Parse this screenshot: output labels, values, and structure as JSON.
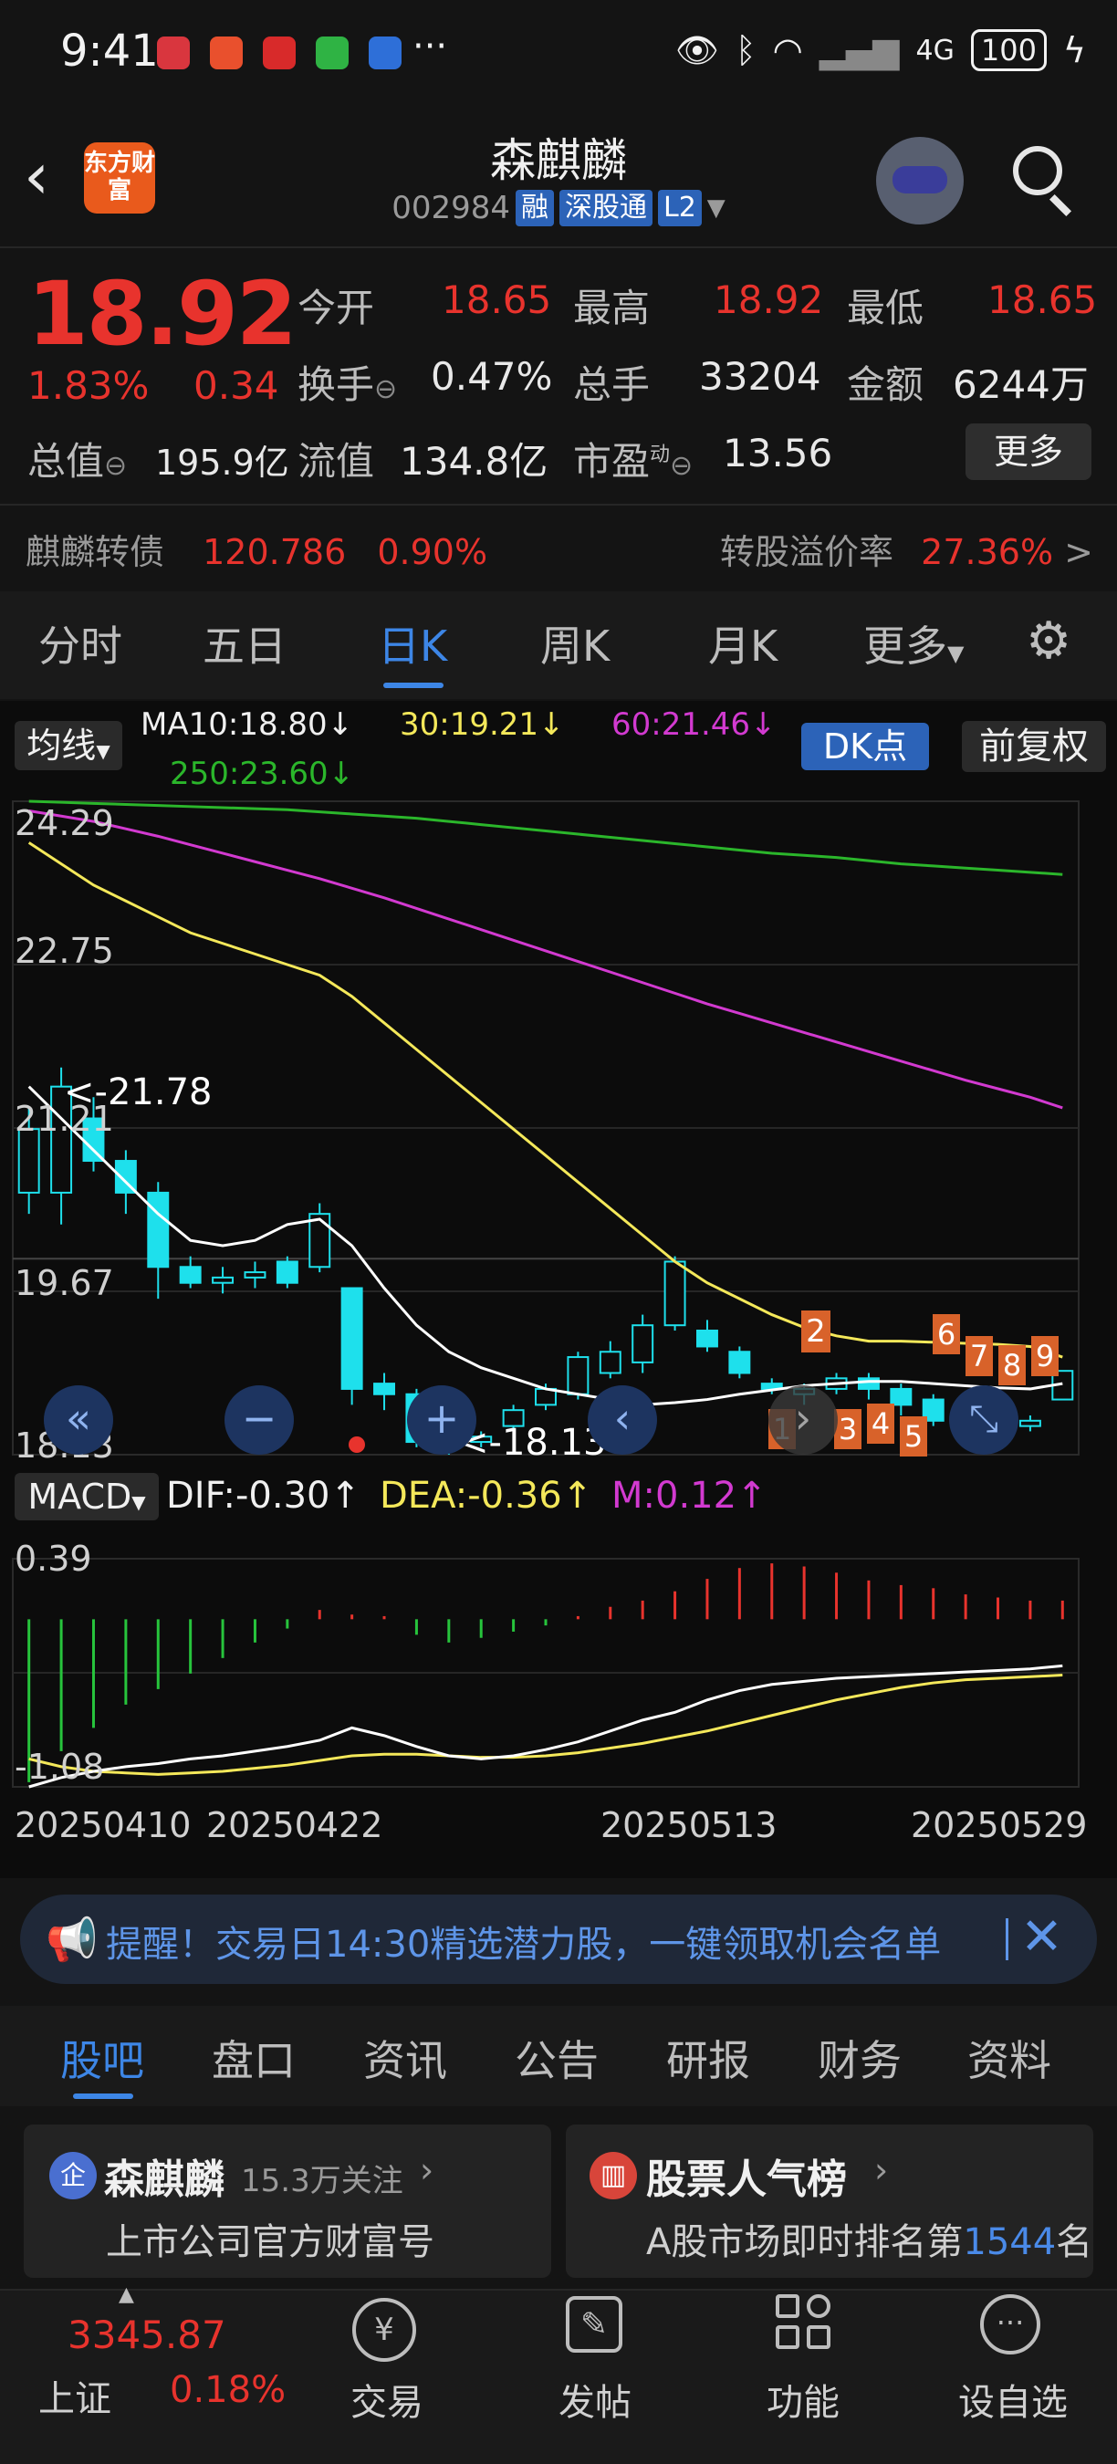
{
  "status_bar": {
    "time": "9:41",
    "more": "···",
    "network": "4G",
    "battery": "100"
  },
  "header": {
    "back_icon": "chevron-left-icon",
    "logo_text": "东方财富",
    "stock_name": "森麒麟",
    "stock_code": "002984",
    "tags": [
      "融",
      "深股通",
      "L2"
    ]
  },
  "quote": {
    "price": "18.92",
    "change_pct": "1.83%",
    "change": "0.34",
    "open_label": "今开",
    "open": "18.65",
    "high_label": "最高",
    "high": "18.92",
    "low_label": "最低",
    "low": "18.65",
    "turnover_label": "换手",
    "turnover": "0.47%",
    "volume_label": "总手",
    "volume": "33204",
    "amount_label": "金额",
    "amount": "6244万",
    "mktcap_label": "总值",
    "mktcap": "195.9亿",
    "float_label": "流值",
    "float": "134.8亿",
    "pe_label": "市盈",
    "pe_sup": "动",
    "pe": "13.56",
    "more_button": "更多"
  },
  "bond": {
    "name": "麒麟转债",
    "price": "120.786",
    "pct": "0.90%",
    "premium_label": "转股溢价率",
    "premium": "27.36%"
  },
  "period_tabs": [
    "分时",
    "五日",
    "日K",
    "周K",
    "月K",
    "更多"
  ],
  "kline": {
    "ma_select": "均线",
    "ma10": "MA10:18.80↓",
    "ma30": "30:19.21↓",
    "ma60": "60:21.46↓",
    "ma250": "250:23.60↓",
    "dk_button": "DK点",
    "adjust_button": "前复权",
    "y_labels": [
      "24.29",
      "22.75",
      "21.21",
      "19.67",
      "18.13"
    ],
    "max_label": "<-21.78",
    "min_label": "<-18.13",
    "td_numbers": [
      "2",
      "1",
      "3",
      "4",
      "5",
      "6",
      "7",
      "8",
      "9"
    ],
    "macd_select": "MACD",
    "dif": "DIF:-0.30↑",
    "dea": "DEA:-0.36↑",
    "m": "M:0.12↑",
    "macd_top": "0.39",
    "macd_bottom": "-1.08",
    "dates": [
      "20250410",
      "20250422",
      "20250513",
      "20250529"
    ],
    "colors": {
      "up": "#e8332d",
      "down": "#1ee0ec",
      "ma10": "#ffffff",
      "ma30": "#f4e85a",
      "ma60": "#d23ad0",
      "ma250": "#2bb62b"
    }
  },
  "chart_data": {
    "type": "candlestick",
    "y_range": [
      18.13,
      24.29
    ],
    "candles": [
      {
        "o": 20.6,
        "c": 21.2,
        "h": 21.4,
        "l": 20.4
      },
      {
        "o": 20.6,
        "c": 21.6,
        "h": 21.78,
        "l": 20.3
      },
      {
        "o": 21.3,
        "c": 20.9,
        "h": 21.5,
        "l": 20.8
      },
      {
        "o": 20.9,
        "c": 20.6,
        "h": 21.0,
        "l": 20.4
      },
      {
        "o": 20.6,
        "c": 19.9,
        "h": 20.7,
        "l": 19.6
      },
      {
        "o": 19.9,
        "c": 19.75,
        "h": 20.0,
        "l": 19.7
      },
      {
        "o": 19.75,
        "c": 19.8,
        "h": 19.9,
        "l": 19.65
      },
      {
        "o": 19.8,
        "c": 19.85,
        "h": 19.95,
        "l": 19.7
      },
      {
        "o": 19.95,
        "c": 19.75,
        "h": 20.0,
        "l": 19.7
      },
      {
        "o": 19.9,
        "c": 20.4,
        "h": 20.5,
        "l": 19.85
      },
      {
        "o": 19.7,
        "c": 18.75,
        "h": 19.7,
        "l": 18.6
      },
      {
        "o": 18.8,
        "c": 18.7,
        "h": 18.9,
        "l": 18.55
      },
      {
        "o": 18.7,
        "c": 18.25,
        "h": 18.75,
        "l": 18.2
      },
      {
        "o": 18.3,
        "c": 18.2,
        "h": 18.35,
        "l": 18.13
      },
      {
        "o": 18.25,
        "c": 18.3,
        "h": 18.35,
        "l": 18.2
      },
      {
        "o": 18.4,
        "c": 18.55,
        "h": 18.6,
        "l": 18.35
      },
      {
        "o": 18.6,
        "c": 18.75,
        "h": 18.8,
        "l": 18.55
      },
      {
        "o": 18.7,
        "c": 19.05,
        "h": 19.1,
        "l": 18.65
      },
      {
        "o": 18.9,
        "c": 19.1,
        "h": 19.2,
        "l": 18.85
      },
      {
        "o": 19.0,
        "c": 19.35,
        "h": 19.45,
        "l": 18.9
      },
      {
        "o": 19.35,
        "c": 19.95,
        "h": 20.0,
        "l": 19.3
      },
      {
        "o": 19.3,
        "c": 19.15,
        "h": 19.4,
        "l": 19.1
      },
      {
        "o": 19.1,
        "c": 18.9,
        "h": 19.15,
        "l": 18.85
      },
      {
        "o": 18.8,
        "c": 18.75,
        "h": 18.85,
        "l": 18.7
      },
      {
        "o": 18.7,
        "c": 18.75,
        "h": 18.8,
        "l": 18.6
      },
      {
        "o": 18.75,
        "c": 18.85,
        "h": 18.9,
        "l": 18.7
      },
      {
        "o": 18.85,
        "c": 18.75,
        "h": 18.9,
        "l": 18.65
      },
      {
        "o": 18.75,
        "c": 18.6,
        "h": 18.8,
        "l": 18.5
      },
      {
        "o": 18.65,
        "c": 18.45,
        "h": 18.7,
        "l": 18.4
      },
      {
        "o": 18.5,
        "c": 18.35,
        "h": 18.55,
        "l": 18.3
      },
      {
        "o": 18.35,
        "c": 18.4,
        "h": 18.45,
        "l": 18.3
      },
      {
        "o": 18.4,
        "c": 18.45,
        "h": 18.5,
        "l": 18.35
      },
      {
        "o": 18.65,
        "c": 18.92,
        "h": 18.92,
        "l": 18.65
      }
    ],
    "ma10": [
      21.6,
      21.3,
      21.0,
      20.7,
      20.4,
      20.15,
      20.1,
      20.15,
      20.3,
      20.35,
      20.1,
      19.7,
      19.35,
      19.1,
      18.95,
      18.85,
      18.75,
      18.7,
      18.65,
      18.6,
      18.62,
      18.65,
      18.7,
      18.74,
      18.78,
      18.8,
      18.82,
      18.82,
      18.8,
      18.78,
      18.76,
      18.75,
      18.8
    ],
    "ma30": [
      23.9,
      23.7,
      23.5,
      23.35,
      23.2,
      23.05,
      22.95,
      22.85,
      22.75,
      22.65,
      22.45,
      22.2,
      21.95,
      21.7,
      21.45,
      21.2,
      20.95,
      20.7,
      20.45,
      20.2,
      19.95,
      19.75,
      19.6,
      19.45,
      19.33,
      19.25,
      19.2,
      19.2,
      19.19,
      19.18,
      19.17,
      19.15,
      19.05
    ],
    "ma60": [
      24.2,
      24.15,
      24.1,
      24.03,
      23.96,
      23.88,
      23.8,
      23.72,
      23.64,
      23.56,
      23.47,
      23.38,
      23.28,
      23.18,
      23.08,
      22.98,
      22.88,
      22.78,
      22.68,
      22.58,
      22.48,
      22.38,
      22.29,
      22.2,
      22.11,
      22.02,
      21.93,
      21.84,
      21.75,
      21.66,
      21.58,
      21.5,
      21.4
    ],
    "ma250": [
      24.29,
      24.28,
      24.27,
      24.26,
      24.25,
      24.24,
      24.23,
      24.22,
      24.21,
      24.19,
      24.17,
      24.15,
      24.13,
      24.1,
      24.07,
      24.04,
      24.01,
      23.98,
      23.95,
      23.92,
      23.89,
      23.86,
      23.83,
      23.8,
      23.78,
      23.76,
      23.73,
      23.7,
      23.68,
      23.66,
      23.64,
      23.62,
      23.6
    ],
    "macd_range": [
      -1.08,
      0.39
    ],
    "macd_hist": [
      -1.05,
      -0.85,
      -0.7,
      -0.55,
      -0.45,
      -0.35,
      -0.25,
      -0.15,
      -0.06,
      0.06,
      0.03,
      0.02,
      -0.1,
      -0.15,
      -0.12,
      -0.08,
      -0.04,
      0.02,
      0.08,
      0.12,
      0.18,
      0.26,
      0.33,
      0.36,
      0.34,
      0.3,
      0.25,
      0.22,
      0.2,
      0.16,
      0.14,
      0.12,
      0.12
    ],
    "dif": [
      -1.08,
      -1.02,
      -0.98,
      -0.95,
      -0.93,
      -0.9,
      -0.88,
      -0.85,
      -0.82,
      -0.78,
      -0.7,
      -0.75,
      -0.82,
      -0.88,
      -0.9,
      -0.88,
      -0.84,
      -0.79,
      -0.72,
      -0.65,
      -0.6,
      -0.52,
      -0.46,
      -0.42,
      -0.4,
      -0.38,
      -0.37,
      -0.36,
      -0.35,
      -0.34,
      -0.33,
      -0.32,
      -0.3
    ],
    "dea": [
      -0.9,
      -0.95,
      -0.98,
      -0.99,
      -1.0,
      -0.99,
      -0.98,
      -0.96,
      -0.94,
      -0.91,
      -0.88,
      -0.87,
      -0.87,
      -0.88,
      -0.89,
      -0.89,
      -0.88,
      -0.86,
      -0.83,
      -0.8,
      -0.76,
      -0.72,
      -0.67,
      -0.62,
      -0.57,
      -0.52,
      -0.48,
      -0.44,
      -0.41,
      -0.39,
      -0.38,
      -0.37,
      -0.36
    ]
  },
  "banner": {
    "text": "提醒！交易日14:30精选潜力股，一键领取机会名单",
    "icon": "megaphone-icon"
  },
  "content_tabs": [
    "股吧",
    "盘口",
    "资讯",
    "公告",
    "研报",
    "财务",
    "资料"
  ],
  "cards": {
    "left_title": "森麒麟",
    "left_follow": "15.3万关注",
    "left_sub": "上市公司官方财富号",
    "left_badge": "企",
    "right_title": "股票人气榜",
    "right_sub_prefix": "A股市场即时排名第",
    "right_rank": "1544",
    "right_sub_suffix": "名"
  },
  "bottom_nav": {
    "index_value": "3345.87",
    "index_name": "上证",
    "index_pct": "0.18%",
    "items": [
      "交易",
      "发帖",
      "功能",
      "设自选"
    ]
  }
}
